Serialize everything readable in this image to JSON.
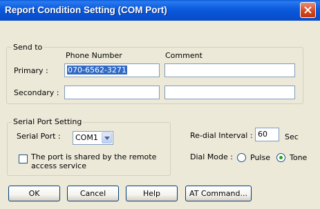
{
  "window": {
    "title": "Report Condition Setting (COM Port)"
  },
  "send_to": {
    "legend": "Send to",
    "col_phone": "Phone Number",
    "col_comment": "Comment",
    "primary_label": "Primary :",
    "primary_phone": "070-6562-3271",
    "primary_comment": "",
    "secondary_label": "Secondary :",
    "secondary_phone": "",
    "secondary_comment": ""
  },
  "serial": {
    "legend": "Serial Port Setting",
    "port_label": "Serial Port :",
    "port_value": "COM1",
    "shared_label_line1": "The port is shared by the remote",
    "shared_label_line2": "access service",
    "shared_checked": false
  },
  "redial": {
    "label": "Re-dial Interval :",
    "value": "60",
    "unit": "Sec"
  },
  "dial_mode": {
    "label": "Dial Mode :",
    "options": [
      "Pulse",
      "Tone"
    ],
    "selected": "Tone"
  },
  "buttons": {
    "ok": "OK",
    "cancel": "Cancel",
    "help": "Help",
    "at_command": "AT Command..."
  }
}
